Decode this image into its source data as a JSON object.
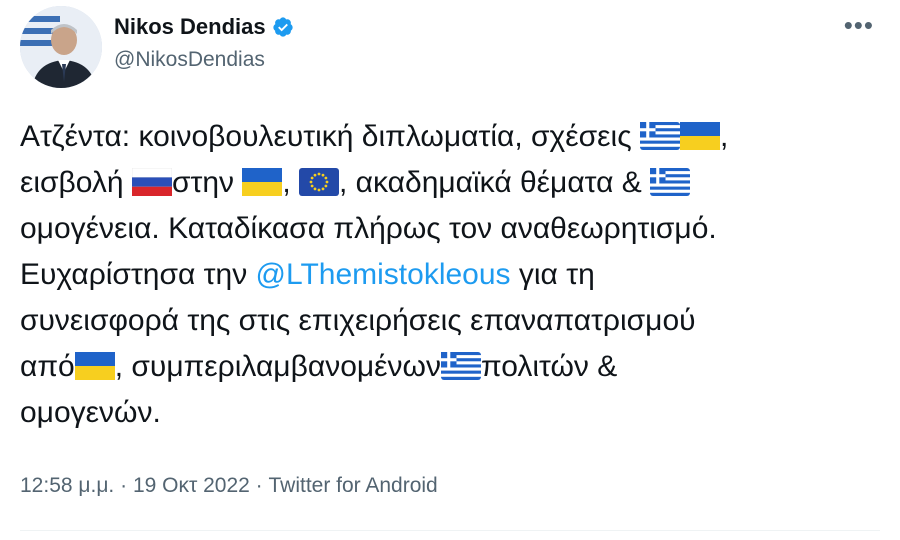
{
  "author": {
    "name": "Nikos Dendias",
    "handle": "@NikosDendias",
    "verified": true
  },
  "tweet": {
    "line1_a": "Ατζέντα: κοινοβουλευτική διπλωματία, σχέσεις ",
    "line1_b": ",",
    "line2_a": "εισβολή ",
    "line2_b": "στην ",
    "line2_c": ", ",
    "line2_d": ", ακαδημαϊκά θέματα & ",
    "line3": "ομογένεια. Καταδίκασα πλήρως τον αναθεωρητισμό.",
    "line4_a": "Ευχαρίστησα την ",
    "mention": "@LThemistokleous",
    "line4_b": " για τη",
    "line5": "συνεισφορά της στις επιχειρήσεις επαναπατρισμού",
    "line6_a": "από",
    "line6_b": ", συμπεριλαμβανομένων",
    "line6_c": "πολιτών &",
    "line7": "ομογενών."
  },
  "meta": {
    "time": "12:58 μ.μ.",
    "sep1": " · ",
    "date": "19 Οκτ 2022",
    "sep2": " · ",
    "source": "Twitter for Android"
  },
  "icons": {
    "more": "more-icon",
    "verified": "verified-badge-icon",
    "flags": [
      "greece-flag-icon",
      "ukraine-flag-icon",
      "russia-flag-icon",
      "eu-flag-icon"
    ]
  },
  "colors": {
    "link": "#1d9bf0",
    "secondary_text": "#536471",
    "text": "#0f1419",
    "verified": "#1d9bf0"
  }
}
